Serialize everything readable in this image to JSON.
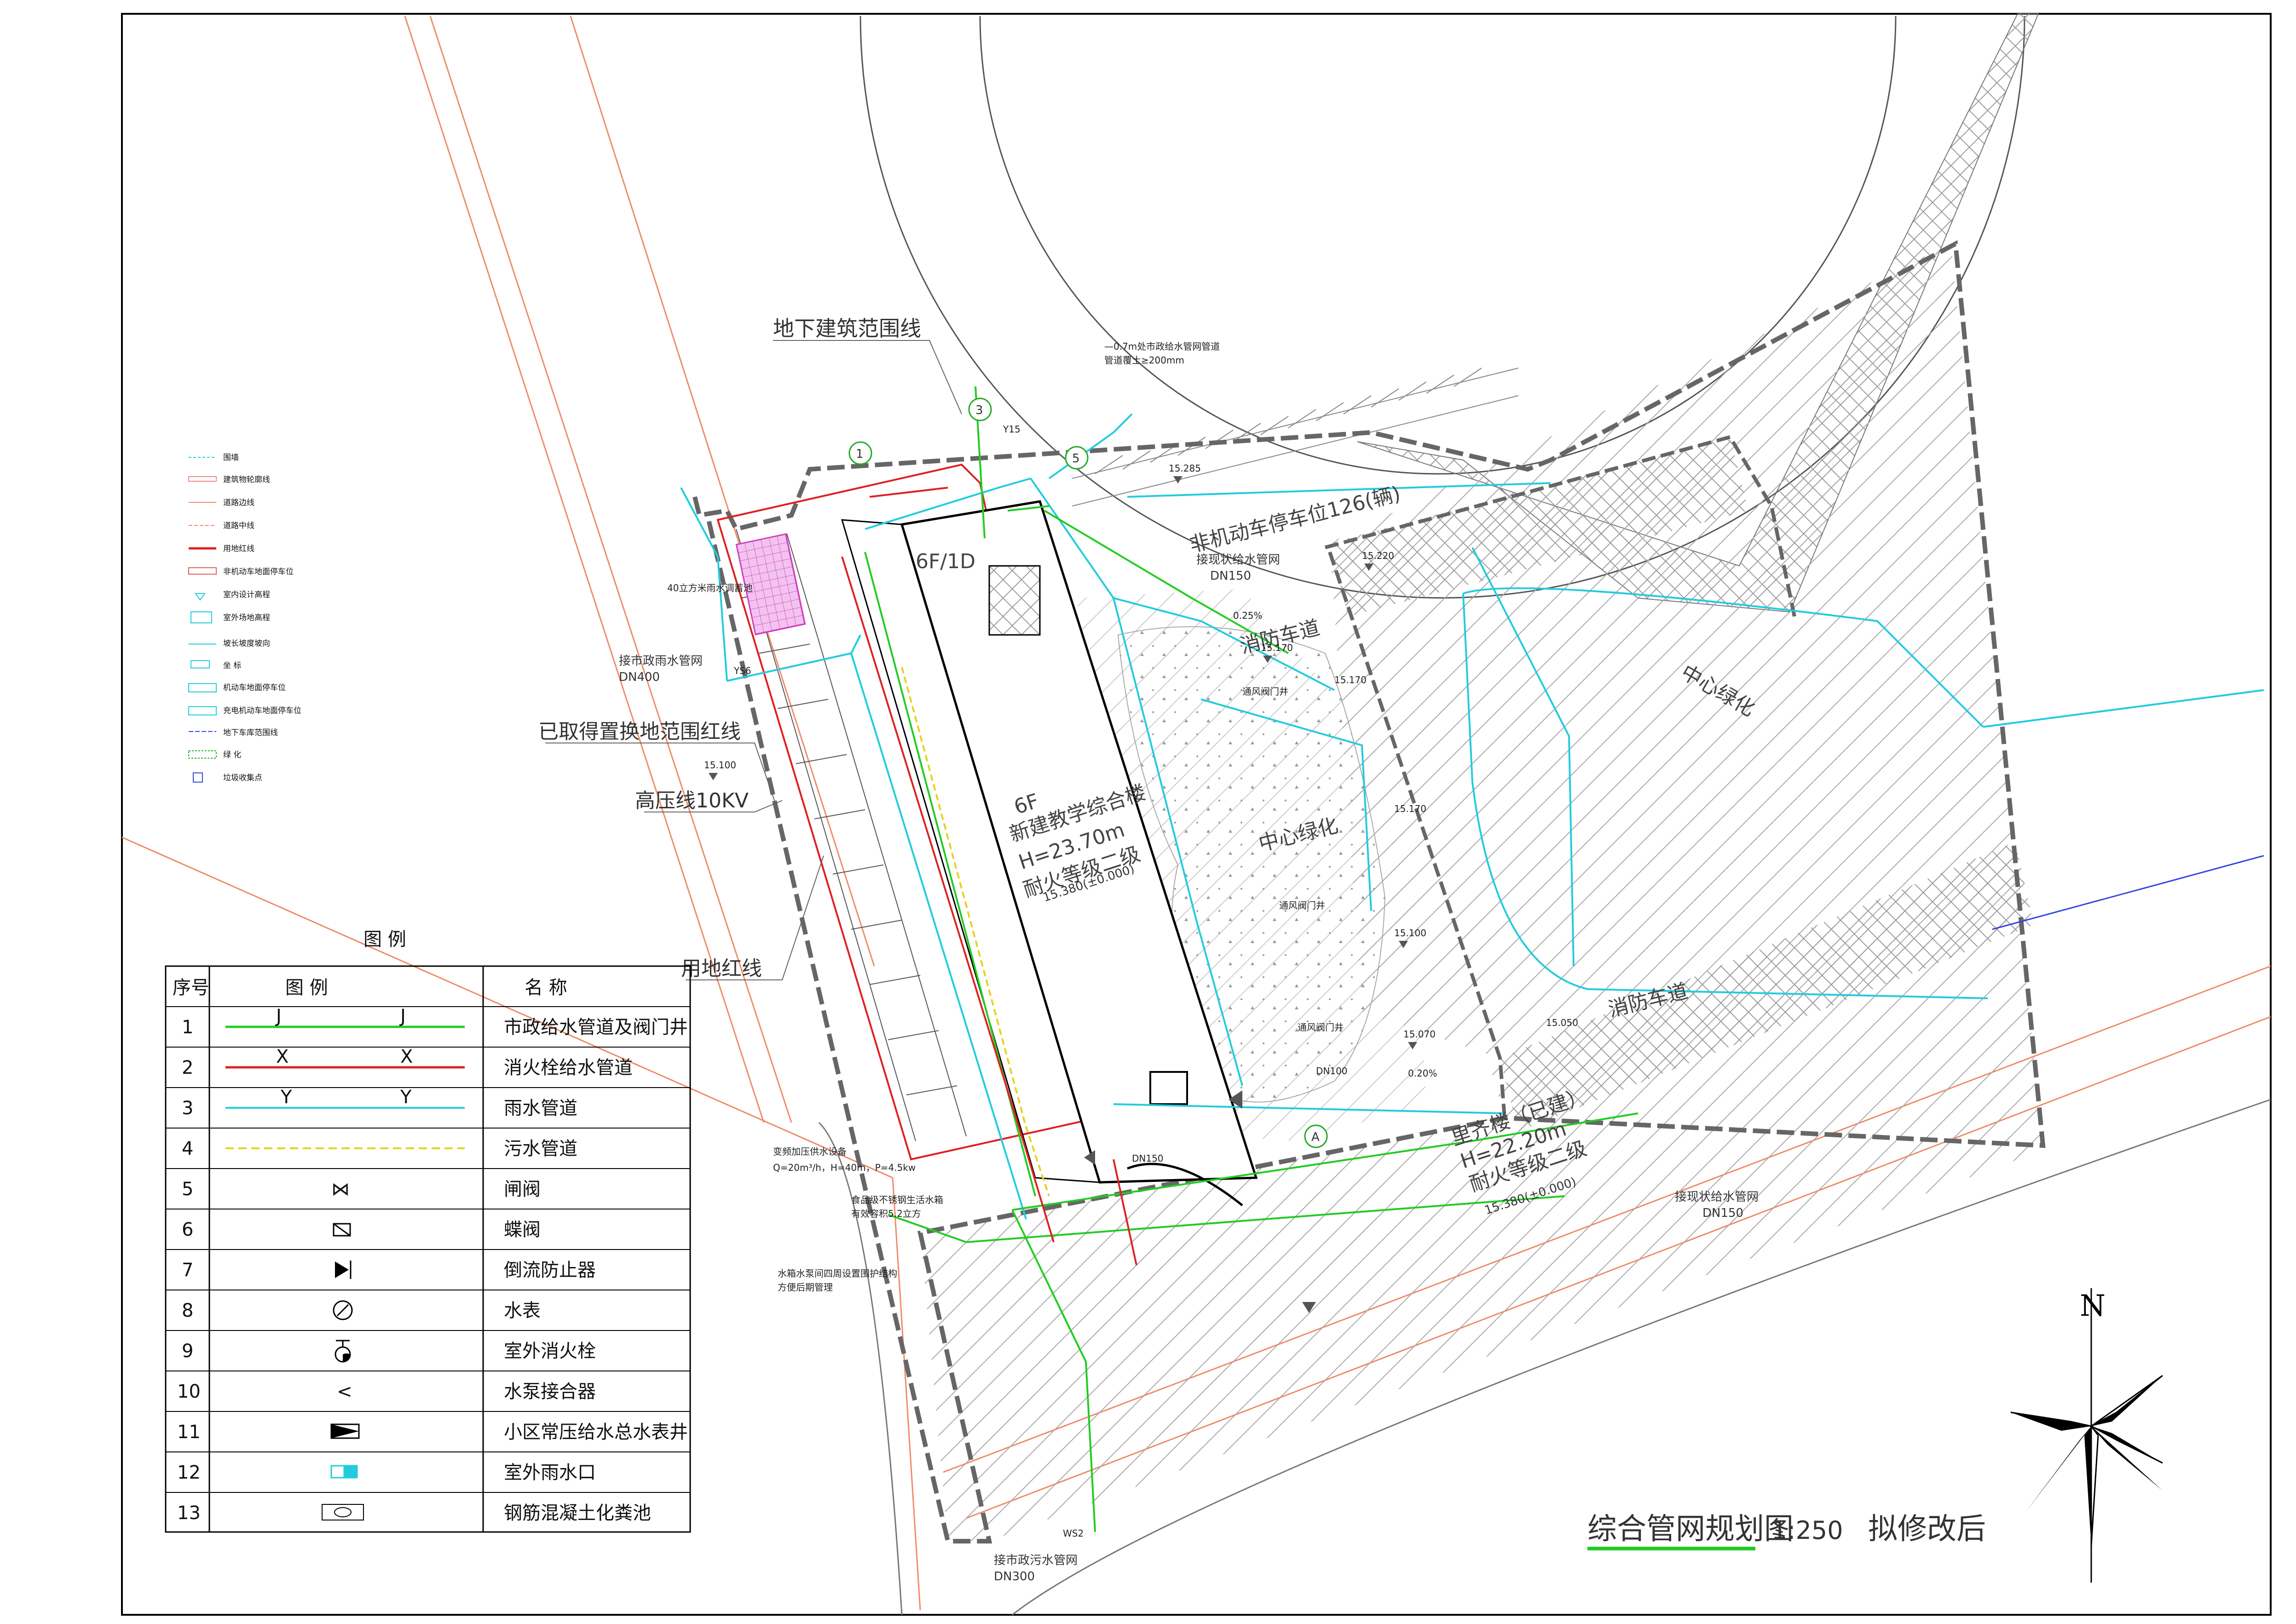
{
  "labels": {
    "underground_range": "地下建筑范围线",
    "replacement_range": "已取得置换地范围红线",
    "high_voltage": "高压线10KV",
    "land_red_line": "用地红线",
    "municipal_rain": "接市政雨水管网",
    "municipal_rain_dn": "DN400",
    "existing_water_nw": "接现状给水管网",
    "existing_water_nw_dn": "DN150",
    "existing_water_se": "接现状给水管网",
    "existing_water_se_dn": "DN150",
    "sewer": "接市政污水管网",
    "sewer_dn": "DN300",
    "bike_parking": "非机动车停车位126(辆)",
    "fire_lane_top": "消防车道",
    "fire_lane_right": "消防车道",
    "central_green_top": "中心绿化",
    "central_green_mid": "中心绿化",
    "pump": "变频加压供水设备",
    "pump_spec": "Q=20m³/h，H=40m，P=4.5kw",
    "tank": "食品级不锈钢生活水箱",
    "tank_spec": "有效容积5.2立方",
    "pump_room_note1": "水箱水泵间四周设置围护结构",
    "pump_room_note2": "方便后期管理",
    "tank_40": "40立方米雨水调蓄池",
    "road_note1": "—0.7m处市政给水管网管道",
    "road_note2": "管道覆土≥200mm",
    "bldg_floors": "6F",
    "bldg_name": "新建教学综合楼",
    "bldg_h": "H=23.70m",
    "bldg_fire": "耐火等级二级",
    "bldg_elev": "15.380(±0.000)",
    "bldg_small": "6F/1D",
    "old_bldg_name": "里齐楼（已建）",
    "old_bldg_h": "H=22.20m",
    "old_bldg_fire": "耐火等级二级",
    "old_bldg_elev": "15.380(±0.000)",
    "vent_well_1": "通风阀门井",
    "vent_well_2": "通风阀门井",
    "vent_well_3": "通风阀门井",
    "axis_1": "1",
    "axis_3": "3",
    "axis_5": "5",
    "axis_a": "A",
    "elev_1": "15.285",
    "elev_2": "15.220",
    "elev_3": "15.170",
    "elev_4": "15.170",
    "elev_5": "15.100",
    "elev_6": "15.100",
    "elev_7": "15.050",
    "elev_8": "15.070",
    "elev_9": "15.170",
    "slope_1": "0.25%",
    "slope_2": "0.20%",
    "pipe_y15": "Y15",
    "pipe_ys6": "YS6",
    "pipe_ws2": "WS2",
    "pipe_dn150": "DN150",
    "pipe_dn100": "DN100"
  },
  "key_legend": {
    "items": [
      "围墙",
      "建筑物轮廓线",
      "道路边线",
      "道路中线",
      "用地红线",
      "非机动车地面停车位",
      "室内设计高程",
      "室外场地高程",
      "坡长坡度坡向",
      "坐 标",
      "机动车地面停车位",
      "充电机动车地面停车位",
      "地下车库范围线",
      "绿 化",
      "垃圾收集点"
    ]
  },
  "legend": {
    "title": "图        例",
    "col_no": "序号",
    "col_symbol": "图        例",
    "col_name": "名        称",
    "rows": [
      {
        "no": "1",
        "name": "市政给水管道及阀门井",
        "sym": "J"
      },
      {
        "no": "2",
        "name": "消火栓给水管道",
        "sym": "X"
      },
      {
        "no": "3",
        "name": "雨水管道",
        "sym": "Y"
      },
      {
        "no": "4",
        "name": "污水管道",
        "sym": ""
      },
      {
        "no": "5",
        "name": "闸阀",
        "sym": "⋈"
      },
      {
        "no": "6",
        "name": "蝶阀",
        "sym": ""
      },
      {
        "no": "7",
        "name": "倒流防止器",
        "sym": ""
      },
      {
        "no": "8",
        "name": "水表",
        "sym": ""
      },
      {
        "no": "9",
        "name": "室外消火栓",
        "sym": ""
      },
      {
        "no": "10",
        "name": "水泵接合器",
        "sym": "<"
      },
      {
        "no": "11",
        "name": "小区常压给水总水表井",
        "sym": ""
      },
      {
        "no": "12",
        "name": "室外雨水口",
        "sym": ""
      },
      {
        "no": "13",
        "name": "钢筋混凝土化粪池",
        "sym": ""
      }
    ],
    "colors": {
      "water": "#22cc22",
      "fire": "#dd2222",
      "rain": "#22ccdd",
      "sewage": "#e6d21e"
    }
  },
  "title_block": {
    "title": "综合管网规划图",
    "scale": "1:250",
    "status": "拟修改后"
  },
  "compass": {
    "north": "N"
  }
}
